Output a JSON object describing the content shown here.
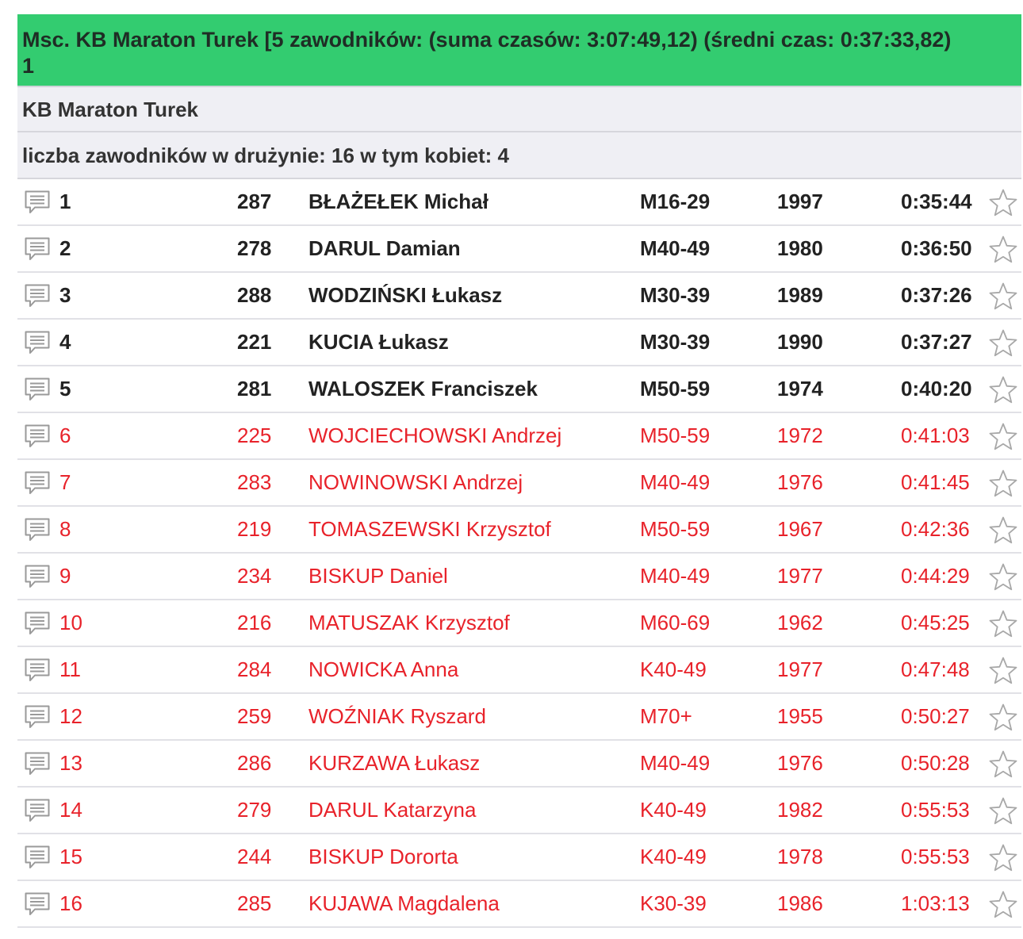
{
  "header": {
    "title": "Msc.  KB Maraton Turek [5 zawodników: (suma czasów: 3:07:49,12) (średni czas: 0:37:33,82)",
    "place": "1"
  },
  "team_name": "KB Maraton Turek",
  "team_count": "liczba zawodników w drużynie: 16 w tym kobiet: 4",
  "colors": {
    "header_bg": "#33cc70",
    "scored_text": "#222222",
    "other_text": "#e8222a",
    "info_bg": "#efeff4"
  },
  "icons": {
    "row_left": "comment-icon",
    "row_right": "star-icon"
  },
  "rows": [
    {
      "place": "1",
      "bib": "287",
      "name": "BŁAŻEŁEK Michał",
      "cat": "M16-29",
      "year": "1997",
      "time": "0:35:44",
      "scored": true
    },
    {
      "place": "2",
      "bib": "278",
      "name": "DARUL Damian",
      "cat": "M40-49",
      "year": "1980",
      "time": "0:36:50",
      "scored": true
    },
    {
      "place": "3",
      "bib": "288",
      "name": "WODZIŃSKI Łukasz",
      "cat": "M30-39",
      "year": "1989",
      "time": "0:37:26",
      "scored": true
    },
    {
      "place": "4",
      "bib": "221",
      "name": "KUCIA Łukasz",
      "cat": "M30-39",
      "year": "1990",
      "time": "0:37:27",
      "scored": true
    },
    {
      "place": "5",
      "bib": "281",
      "name": "WALOSZEK Franciszek",
      "cat": "M50-59",
      "year": "1974",
      "time": "0:40:20",
      "scored": true
    },
    {
      "place": "6",
      "bib": "225",
      "name": "WOJCIECHOWSKI Andrzej",
      "cat": "M50-59",
      "year": "1972",
      "time": "0:41:03",
      "scored": false
    },
    {
      "place": "7",
      "bib": "283",
      "name": "NOWINOWSKI Andrzej",
      "cat": "M40-49",
      "year": "1976",
      "time": "0:41:45",
      "scored": false
    },
    {
      "place": "8",
      "bib": "219",
      "name": "TOMASZEWSKI Krzysztof",
      "cat": "M50-59",
      "year": "1967",
      "time": "0:42:36",
      "scored": false
    },
    {
      "place": "9",
      "bib": "234",
      "name": "BISKUP Daniel",
      "cat": "M40-49",
      "year": "1977",
      "time": "0:44:29",
      "scored": false
    },
    {
      "place": "10",
      "bib": "216",
      "name": "MATUSZAK Krzysztof",
      "cat": "M60-69",
      "year": "1962",
      "time": "0:45:25",
      "scored": false
    },
    {
      "place": "11",
      "bib": "284",
      "name": "NOWICKA Anna",
      "cat": "K40-49",
      "year": "1977",
      "time": "0:47:48",
      "scored": false
    },
    {
      "place": "12",
      "bib": "259",
      "name": "WOŹNIAK Ryszard",
      "cat": "M70+",
      "year": "1955",
      "time": "0:50:27",
      "scored": false
    },
    {
      "place": "13",
      "bib": "286",
      "name": "KURZAWA Łukasz",
      "cat": "M40-49",
      "year": "1976",
      "time": "0:50:28",
      "scored": false
    },
    {
      "place": "14",
      "bib": "279",
      "name": "DARUL Katarzyna",
      "cat": "K40-49",
      "year": "1982",
      "time": "0:55:53",
      "scored": false
    },
    {
      "place": "15",
      "bib": "244",
      "name": "BISKUP Dororta",
      "cat": "K40-49",
      "year": "1978",
      "time": "0:55:53",
      "scored": false
    },
    {
      "place": "16",
      "bib": "285",
      "name": "KUJAWA Magdalena",
      "cat": "K30-39",
      "year": "1986",
      "time": "1:03:13",
      "scored": false
    }
  ]
}
